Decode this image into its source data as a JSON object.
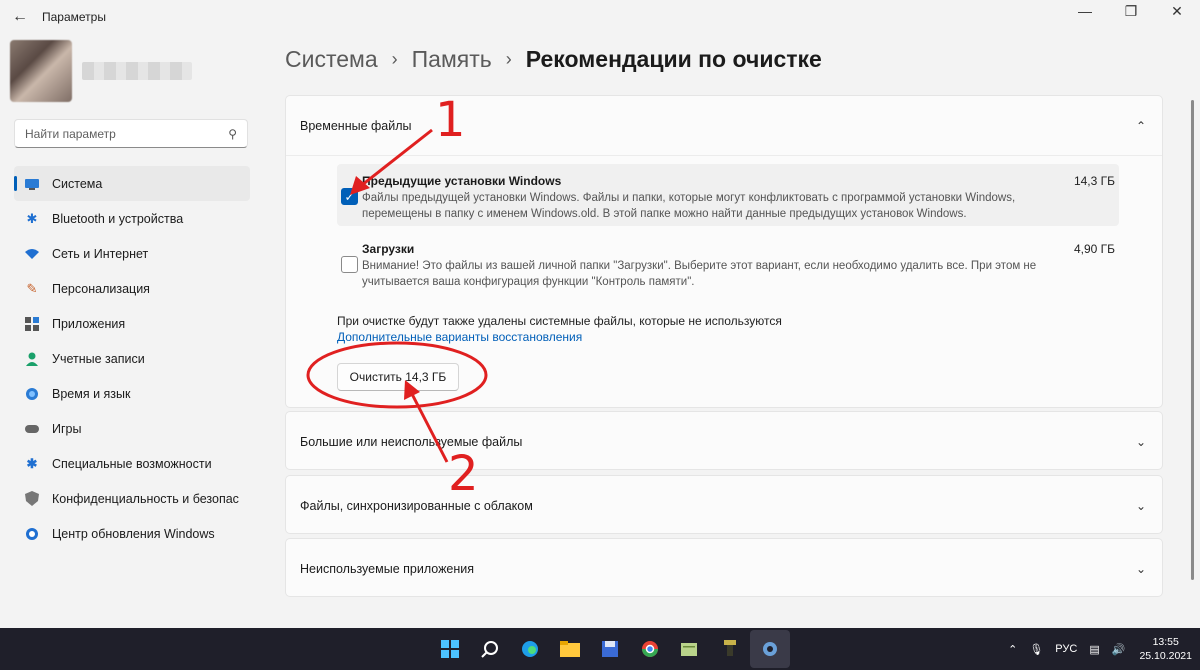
{
  "window": {
    "app_title": "Параметры",
    "back_icon": "←"
  },
  "sidebar": {
    "search_placeholder": "Найти параметр",
    "items": [
      {
        "label": "Система",
        "icon": "system-icon",
        "active": true
      },
      {
        "label": "Bluetooth и устройства",
        "icon": "bluetooth-icon"
      },
      {
        "label": "Сеть и Интернет",
        "icon": "wifi-icon"
      },
      {
        "label": "Персонализация",
        "icon": "brush-icon"
      },
      {
        "label": "Приложения",
        "icon": "apps-icon"
      },
      {
        "label": "Учетные записи",
        "icon": "account-icon"
      },
      {
        "label": "Время и язык",
        "icon": "globe-icon"
      },
      {
        "label": "Игры",
        "icon": "gamepad-icon"
      },
      {
        "label": "Специальные возможности",
        "icon": "accessibility-icon"
      },
      {
        "label": "Конфиденциальность и безопас",
        "icon": "shield-icon"
      },
      {
        "label": "Центр обновления Windows",
        "icon": "update-icon"
      }
    ]
  },
  "breadcrumb": {
    "items": [
      "Система",
      "Память"
    ],
    "current": "Рекомендации по очистке"
  },
  "temp_files": {
    "header": "Временные файлы",
    "items": [
      {
        "title": "Предыдущие установки Windows",
        "size": "14,3 ГБ",
        "checked": true,
        "desc": "Файлы предыдущей установки Windows.  Файлы и папки, которые могут конфликтовать с программой установки Windows, перемещены в папку с именем Windows.old.  В этой папке можно найти данные предыдущих установок Windows."
      },
      {
        "title": "Загрузки",
        "size": "4,90 ГБ",
        "checked": false,
        "desc": "Внимание! Это файлы из вашей личной папки \"Загрузки\". Выберите этот вариант, если необходимо удалить все. При этом не учитывается ваша конфигурация функции \"Контроль памяти\"."
      }
    ],
    "note": "При очистке будут также удалены системные файлы, которые не используются",
    "link": "Дополнительные варианты восстановления",
    "clean_button": "Очистить 14,3 ГБ"
  },
  "sections": [
    {
      "header": "Большие или неиспользуемые файлы"
    },
    {
      "header": "Файлы, синхронизированные с облаком"
    },
    {
      "header": "Неиспользуемые приложения"
    }
  ],
  "annotations": {
    "one": "1",
    "two": "2",
    "color": "#e02020"
  },
  "taskbar": {
    "lang": "РУС",
    "time": "13:55",
    "date": "25.10.2021"
  }
}
